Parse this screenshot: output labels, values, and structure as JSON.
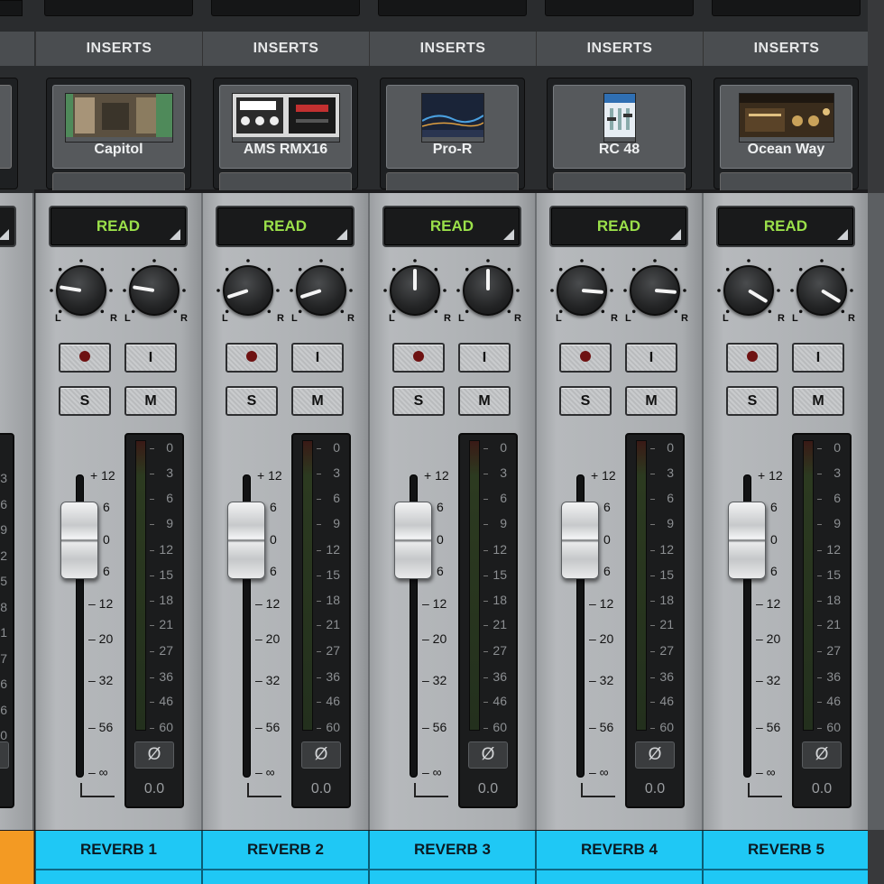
{
  "partial_channel": {
    "meter_ticks": [
      "3",
      "6",
      "9",
      "2",
      "5",
      "8",
      "1",
      "7",
      "6",
      "6",
      "0"
    ]
  },
  "channels": [
    {
      "insert_header": "INSERTS",
      "insert_plugin": "Capitol",
      "plugin_thumbnail_icon": "capitol-plugin-icon",
      "automation_mode": "READ",
      "pan_left_label": "L",
      "pan_right_label": "R",
      "pan_left_value": -0.6,
      "pan_right_value": -0.6,
      "record_button_icon": "record-dot-icon",
      "input_button_label": "I",
      "solo_label": "S",
      "mute_label": "M",
      "phase_label": "Ø",
      "gain_display": "0.0",
      "name": "REVERB 1"
    },
    {
      "insert_header": "INSERTS",
      "insert_plugin": "AMS RMX16",
      "plugin_thumbnail_icon": "ams-rmx16-plugin-icon",
      "automation_mode": "READ",
      "pan_left_label": "L",
      "pan_right_label": "R",
      "pan_left_value": -0.8,
      "pan_right_value": -0.8,
      "record_button_icon": "record-dot-icon",
      "input_button_label": "I",
      "solo_label": "S",
      "mute_label": "M",
      "phase_label": "Ø",
      "gain_display": "0.0",
      "name": "REVERB 2"
    },
    {
      "insert_header": "INSERTS",
      "insert_plugin": "Pro-R",
      "plugin_thumbnail_icon": "pro-r-plugin-icon",
      "automation_mode": "READ",
      "pan_left_label": "L",
      "pan_right_label": "R",
      "pan_left_value": 0.0,
      "pan_right_value": 0.0,
      "record_button_icon": "record-dot-icon",
      "input_button_label": "I",
      "solo_label": "S",
      "mute_label": "M",
      "phase_label": "Ø",
      "gain_display": "0.0",
      "name": "REVERB 3"
    },
    {
      "insert_header": "INSERTS",
      "insert_plugin": "RC 48",
      "plugin_thumbnail_icon": "rc48-plugin-icon",
      "automation_mode": "READ",
      "pan_left_label": "L",
      "pan_right_label": "R",
      "pan_left_value": 0.7,
      "pan_right_value": 0.7,
      "record_button_icon": "record-dot-icon",
      "input_button_label": "I",
      "solo_label": "S",
      "mute_label": "M",
      "phase_label": "Ø",
      "gain_display": "0.0",
      "name": "REVERB 4"
    },
    {
      "insert_header": "INSERTS",
      "insert_plugin": "Ocean Way",
      "plugin_thumbnail_icon": "ocean-way-plugin-icon",
      "automation_mode": "READ",
      "pan_left_label": "L",
      "pan_right_label": "R",
      "pan_left_value": 0.9,
      "pan_right_value": 0.9,
      "record_button_icon": "record-dot-icon",
      "input_button_label": "I",
      "solo_label": "S",
      "mute_label": "M",
      "phase_label": "Ø",
      "gain_display": "0.0",
      "name": "REVERB 5"
    }
  ],
  "fader_scale": [
    "+ 12",
    "6",
    "0",
    "6",
    "– 12",
    "– 20",
    "– 32",
    "– 56",
    "– ∞"
  ],
  "fader_level_db": 0,
  "meter_scale": [
    "0",
    "3",
    "6",
    "9",
    "12",
    "15",
    "18",
    "21",
    "27",
    "36",
    "46",
    "60"
  ],
  "colors": {
    "automation_text": "#9be04a",
    "channel_name_bg": "#1fc8f5",
    "partial_channel_name_bg": "#f39a23"
  }
}
